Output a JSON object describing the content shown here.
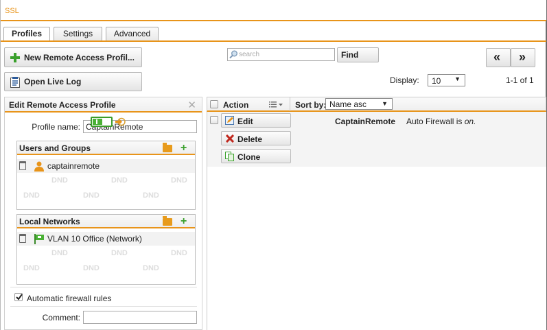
{
  "window": {
    "title": "SSL"
  },
  "tabs": [
    {
      "label": "Profiles",
      "active": true
    },
    {
      "label": "Settings",
      "active": false
    },
    {
      "label": "Advanced",
      "active": false
    }
  ],
  "toolbar": {
    "new_profile_label": "New Remote Access Profil...",
    "open_live_log_label": "Open Live Log",
    "search_placeholder": "search",
    "find_label": "Find",
    "prev_label": "«",
    "next_label": "»",
    "display_label": "Display:",
    "display_value": "10",
    "pagination": "1-1 of 1"
  },
  "edit_panel": {
    "title": "Edit Remote Access Profile",
    "profile_name_label": "Profile name:",
    "profile_name_value": "CaptainRemote",
    "users_groups": {
      "title": "Users and Groups",
      "items": [
        {
          "label": "captainremote",
          "icon": "user-icon"
        }
      ]
    },
    "local_networks": {
      "title": "Local Networks",
      "items": [
        {
          "label": "VLAN 10 Office (Network)",
          "icon": "network-icon"
        }
      ]
    },
    "dnd_text": "DND",
    "auto_firewall_label": "Automatic firewall rules",
    "auto_firewall_checked": true,
    "comment_label": "Comment:",
    "comment_value": ""
  },
  "grid": {
    "action_header": "Action",
    "sort_by_label": "Sort by:",
    "sort_value": "Name asc",
    "row": {
      "edit_label": "Edit",
      "delete_label": "Delete",
      "clone_label": "Clone",
      "enabled": true,
      "name": "CaptainRemote",
      "status_prefix": "Auto Firewall is ",
      "status_value": "on",
      "status_suffix": "."
    }
  },
  "colors": {
    "accent": "#e8941a",
    "green": "#3aa02c",
    "delete_red": "#c0281e"
  }
}
